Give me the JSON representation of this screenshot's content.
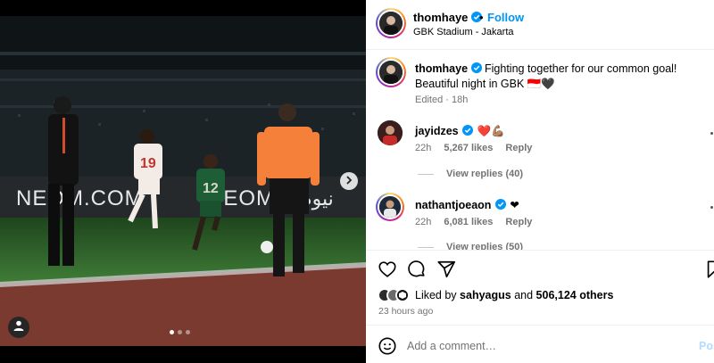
{
  "post": {
    "image_dots": 3,
    "active_dot": 0
  },
  "photo": {
    "board_left": "NEOM.COM",
    "board_middle": "NEOM",
    "board_right": "نيوم",
    "player1_number": "19",
    "player2_number": "12"
  },
  "header": {
    "username": "thomhaye",
    "separator": "•",
    "follow_label": "Follow",
    "location": "GBK Stadium - Jakarta"
  },
  "caption": {
    "username": "thomhaye",
    "text": "Fighting together for our common goal! Beautiful night in GBK 🇮🇩🖤",
    "edited": "Edited",
    "time": "18h",
    "meta_separator": "·"
  },
  "comments": [
    {
      "username": "jayidzes",
      "text": "❤️💪🏽",
      "time": "22h",
      "likes": "5,267 likes",
      "reply_label": "Reply",
      "view_replies": "View replies (40)"
    },
    {
      "username": "nathantjoeaon",
      "text": "❤",
      "time": "22h",
      "likes": "6,081 likes",
      "reply_label": "Reply",
      "view_replies": "View replies (50)"
    }
  ],
  "likes": {
    "prefix": "Liked by",
    "user": "sahyagus",
    "and": "and",
    "others": "506,124 others"
  },
  "posted_ago": "23 hours ago",
  "comment_input": {
    "placeholder": "Add a comment…",
    "post_label": "Post"
  },
  "colors": {
    "accent": "#0095f6",
    "verified": "#0095f6",
    "muted_text": "#737373",
    "referee_shirt": "#f4803a",
    "pitch": "#2f6a2c",
    "track": "#7a3a2f"
  },
  "icons": {
    "like": "heart-icon",
    "comment": "comment-bubble-icon",
    "share": "paper-plane-icon",
    "save": "bookmark-icon",
    "emoji": "smiley-icon",
    "next": "chevron-right-icon",
    "tag": "person-tag-icon"
  }
}
